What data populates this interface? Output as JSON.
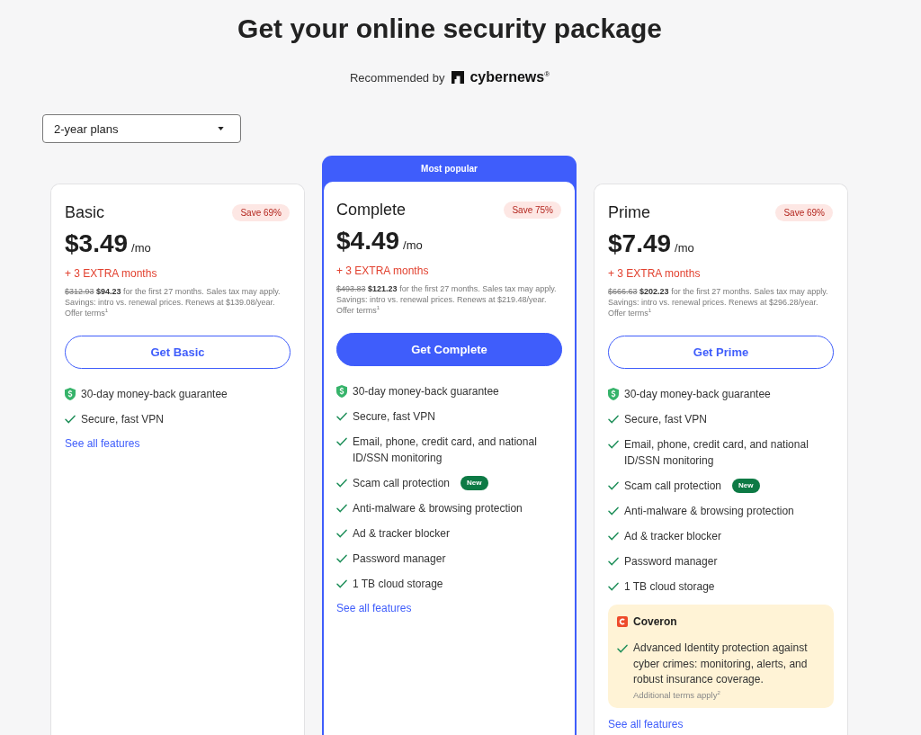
{
  "title": "Get your online security package",
  "recommended": {
    "label": "Recommended by",
    "brand": "cybernews$^{®}$"
  },
  "plan_select": {
    "value": "2-year plans"
  },
  "plans": [
    {
      "name": "Basic",
      "highlighted": false,
      "save": "Save 69%",
      "price": "$3.49",
      "unit": "/mo",
      "extra": "+ 3 EXTRA months",
      "old_total": "$312.93",
      "total": "$94.23",
      "terms": "for the first 27 months. Sales tax may apply. Savings: intro vs. renewal prices. Renews at $139.08/year. Offer terms$^{1}$",
      "button": "Get Basic",
      "features": [
        {
          "kind": "guarantee",
          "text": "30-day money-back guarantee"
        },
        {
          "kind": "check",
          "text": "Secure, fast VPN"
        }
      ],
      "link": "See all features"
    },
    {
      "name": "Complete",
      "highlighted": true,
      "ribbon": "Most popular",
      "save": "Save 75%",
      "price": "$4.49",
      "unit": "/mo",
      "extra": "+ 3 EXTRA months",
      "old_total": "$493.83",
      "total": "$121.23",
      "terms": "for the first 27 months. Sales tax may apply. Savings: intro vs. renewal prices. Renews at $219.48/year. Offer terms$^{1}$",
      "button": "Get Complete",
      "features": [
        {
          "kind": "guarantee",
          "text": "30-day money-back guarantee"
        },
        {
          "kind": "check",
          "text": "Secure, fast VPN"
        },
        {
          "kind": "check",
          "text": "Email, phone, credit card, and national ID/SSN monitoring"
        },
        {
          "kind": "check",
          "text": "Scam call protection",
          "tag": "New"
        },
        {
          "kind": "check",
          "text": "Anti-malware & browsing protection"
        },
        {
          "kind": "check",
          "text": "Ad & tracker blocker"
        },
        {
          "kind": "check",
          "text": "Password manager"
        },
        {
          "kind": "check",
          "text": "1 TB cloud storage"
        }
      ],
      "link": "See all features"
    },
    {
      "name": "Prime",
      "highlighted": false,
      "save": "Save 69%",
      "price": "$7.49",
      "unit": "/mo",
      "extra": "+ 3 EXTRA months",
      "old_total": "$666.63",
      "total": "$202.23",
      "terms": "for the first 27 months. Sales tax may apply. Savings: intro vs. renewal prices. Renews at $296.28/year. Offer terms$^{1}$",
      "button": "Get Prime",
      "features": [
        {
          "kind": "guarantee",
          "text": "30-day money-back guarantee"
        },
        {
          "kind": "check",
          "text": "Secure, fast VPN"
        },
        {
          "kind": "check",
          "text": "Email, phone, credit card, and national ID/SSN monitoring"
        },
        {
          "kind": "check",
          "text": "Scam call protection",
          "tag": "New"
        },
        {
          "kind": "check",
          "text": "Anti-malware & browsing protection"
        },
        {
          "kind": "check",
          "text": "Ad & tracker blocker"
        },
        {
          "kind": "check",
          "text": "Password manager"
        },
        {
          "kind": "check",
          "text": "1 TB cloud storage"
        }
      ],
      "addon": {
        "name": "Coveron",
        "features": [
          {
            "kind": "check",
            "text": "Advanced Identity protection against cyber crimes: monitoring, alerts, and robust insurance coverage."
          }
        ],
        "note": "Additional terms apply$^{2}$"
      },
      "link": "See all features"
    }
  ]
}
